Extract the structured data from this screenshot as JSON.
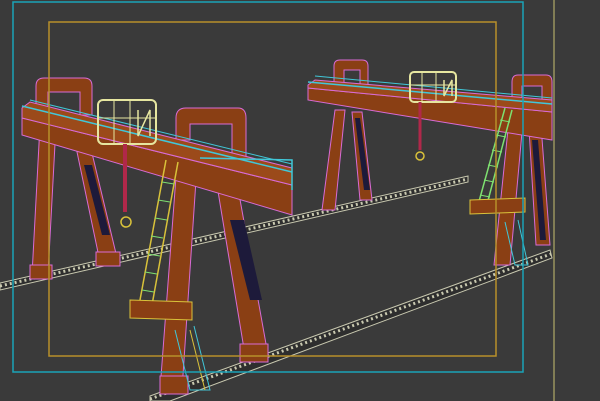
{
  "viewport": {
    "background": "#3a3a3a",
    "safe_frame_outer_color": "#1aa3b8",
    "safe_frame_inner_color": "#b8902a",
    "right_edge_color": "#c8c070"
  },
  "scene": {
    "crane_count": 2,
    "beam_color": "#8a3f14",
    "leg_color": "#8a3f14",
    "wire_pink": "#d86bd6",
    "wire_cyan": "#41c7d8",
    "wire_yellow": "#d9c23a",
    "wire_green": "#7ee070",
    "trolley_color": "#e6e6a0",
    "hook_color": "#b0284a",
    "rail_color": "#c9c9b0"
  }
}
